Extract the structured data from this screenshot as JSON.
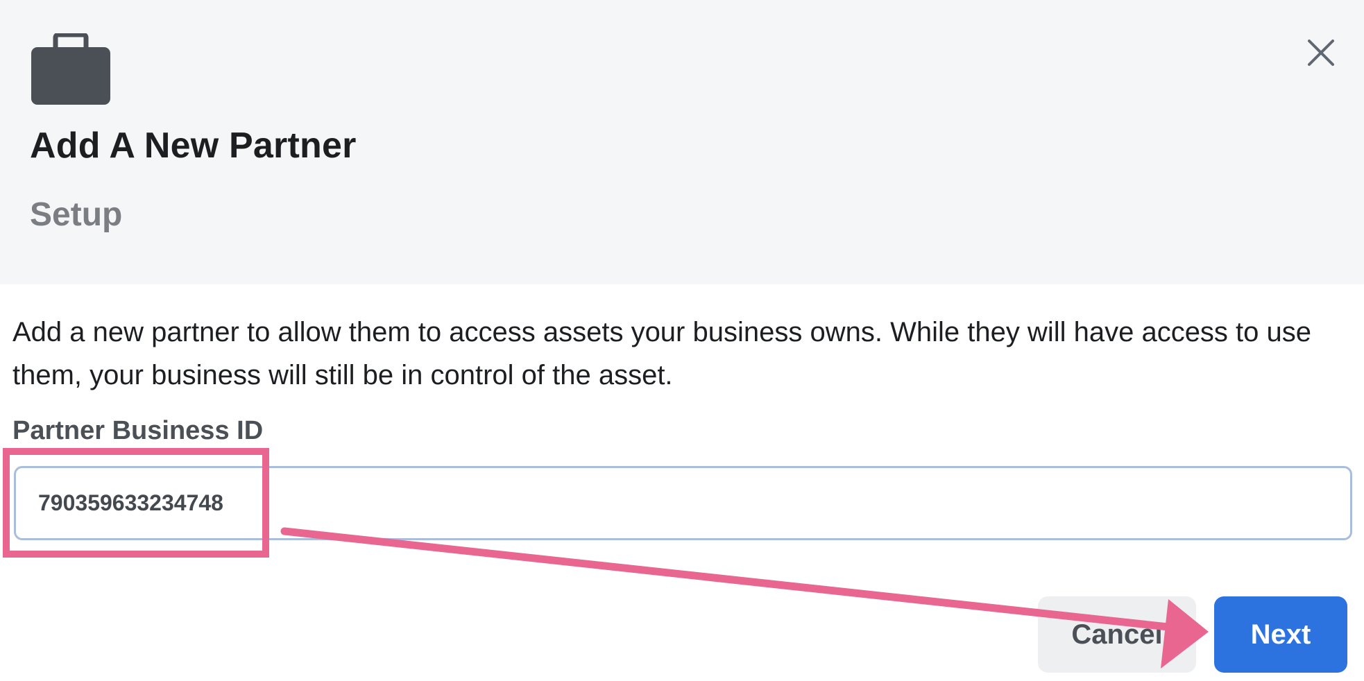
{
  "dialog": {
    "title": "Add A New Partner",
    "subtitle": "Setup",
    "description": "Add a new partner to allow them to access assets your business owns. While they will have access to use them, your business will still be in control of the asset.",
    "icons": {
      "header": "briefcase-icon",
      "close": "close-icon"
    },
    "field": {
      "label": "Partner Business ID",
      "value": "790359633234748"
    },
    "buttons": {
      "cancel": "Cancel",
      "next": "Next"
    }
  },
  "annotation": {
    "color": "#e8668f"
  },
  "colors": {
    "header_background": "#f5f6f7",
    "primary_button": "#2d73e0",
    "secondary_button": "#eeeff1",
    "input_border": "#a9bddf"
  }
}
